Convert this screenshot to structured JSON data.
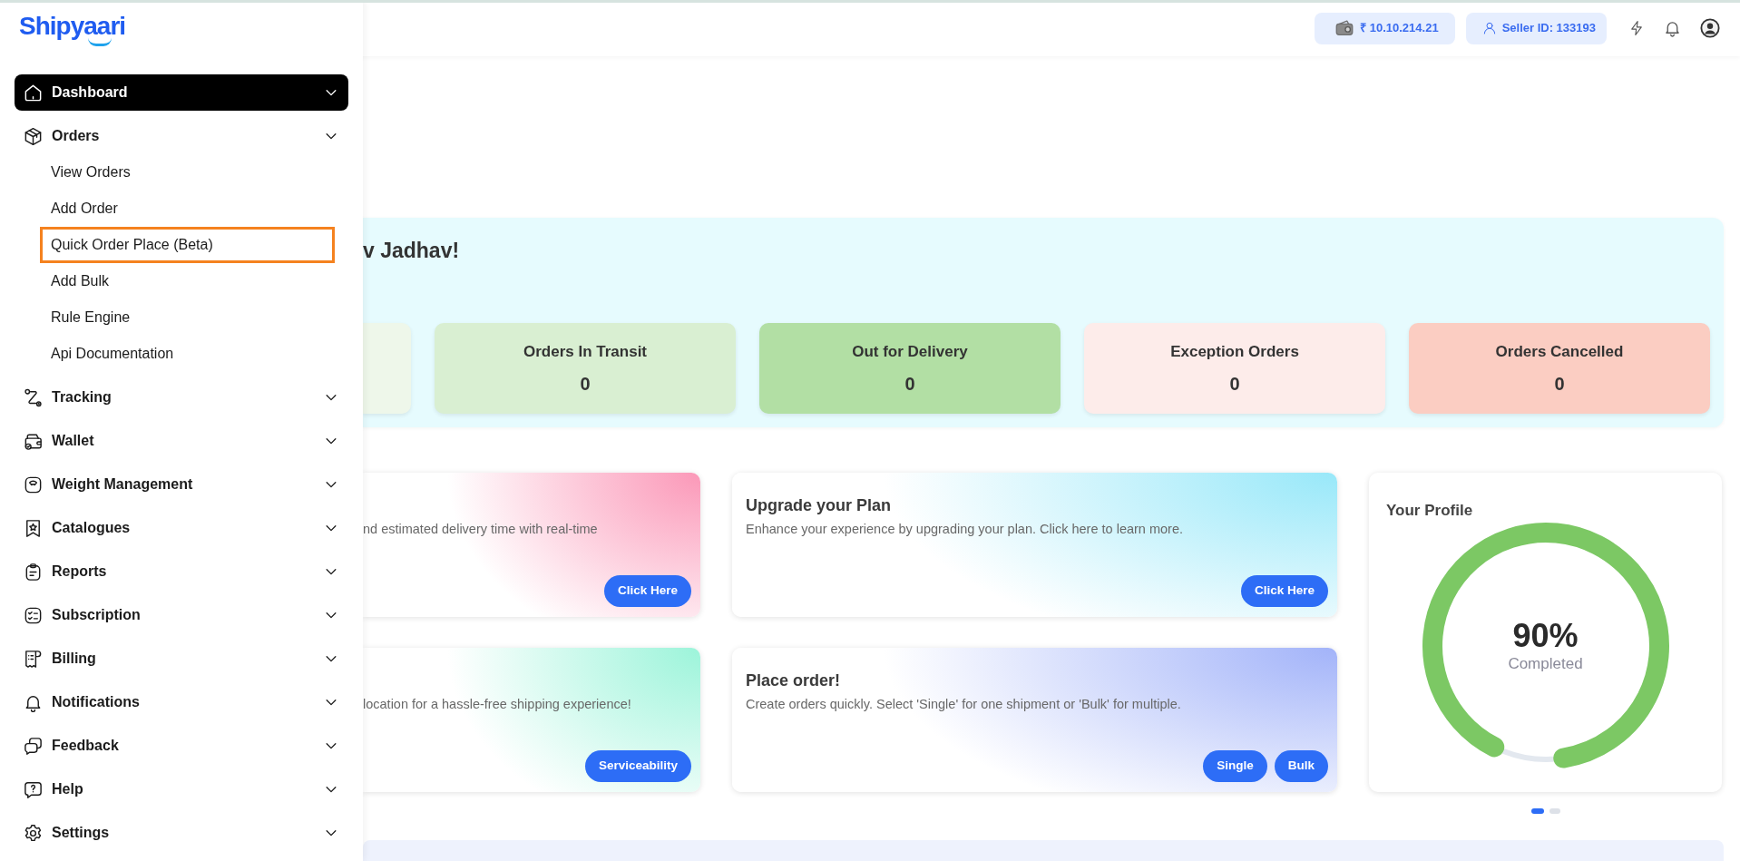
{
  "header": {
    "wallet_balance": "₹ 10.10.214.21",
    "seller_id": "Seller ID: 133193"
  },
  "sidebar": {
    "logo": "Shipyaari",
    "items": [
      {
        "label": "Dashboard",
        "selected": true
      },
      {
        "label": "Orders",
        "selected": false,
        "children": [
          {
            "label": "View Orders",
            "highlighted": false
          },
          {
            "label": "Add Order",
            "highlighted": false
          },
          {
            "label": "Quick Order Place (Beta)",
            "highlighted": true
          },
          {
            "label": "Add Bulk",
            "highlighted": false
          },
          {
            "label": "Rule Engine",
            "highlighted": false
          },
          {
            "label": "Api Documentation",
            "highlighted": false
          }
        ]
      },
      {
        "label": "Tracking",
        "selected": false
      },
      {
        "label": "Wallet",
        "selected": false
      },
      {
        "label": "Weight Management",
        "selected": false
      },
      {
        "label": "Catalogues",
        "selected": false
      },
      {
        "label": "Reports",
        "selected": false
      },
      {
        "label": "Subscription",
        "selected": false
      },
      {
        "label": "Billing",
        "selected": false
      },
      {
        "label": "Notifications",
        "selected": false
      },
      {
        "label": "Feedback",
        "selected": false
      },
      {
        "label": "Help",
        "selected": false
      },
      {
        "label": "Settings",
        "selected": false
      }
    ]
  },
  "welcome": {
    "greeting": "v Jadhav!",
    "stats": [
      {
        "color": "#eef7ea"
      },
      {
        "title": "Orders In Transit",
        "value": "0",
        "color": "#d9efd2"
      },
      {
        "title": "Out for Delivery",
        "value": "0",
        "color": "#b2dfa4"
      },
      {
        "title": "Exception Orders",
        "value": "0",
        "color": "#fdecea"
      },
      {
        "title": "Orders Cancelled",
        "value": "0",
        "color": "#fbcdc2"
      }
    ]
  },
  "cards": [
    {
      "kind": "partial",
      "description": "nd estimated delivery time with real-time",
      "buttons": [
        "Click Here"
      ],
      "color": "#fb98b8"
    },
    {
      "kind": "full",
      "title": "Upgrade your Plan",
      "description": "Enhance your experience by upgrading your plan. Click here to learn more.",
      "buttons": [
        "Click Here"
      ],
      "color": "#98e8f9"
    },
    {
      "kind": "partial",
      "description": "location for a hassle-free shipping experience!",
      "buttons": [
        "Serviceability"
      ],
      "color": "#9cf4da"
    },
    {
      "kind": "full",
      "title": "Place order!",
      "description": "Create orders quickly. Select 'Single' for one shipment or 'Bulk' for multiple.",
      "buttons": [
        "Single",
        "Bulk"
      ],
      "color": "#a2b3f9"
    }
  ],
  "profile": {
    "title": "Your Profile",
    "level": 0.9,
    "percent": "90%",
    "caption": "Completed"
  },
  "carousel_pages": [
    {
      "selected": true
    },
    {
      "selected": false
    }
  ]
}
